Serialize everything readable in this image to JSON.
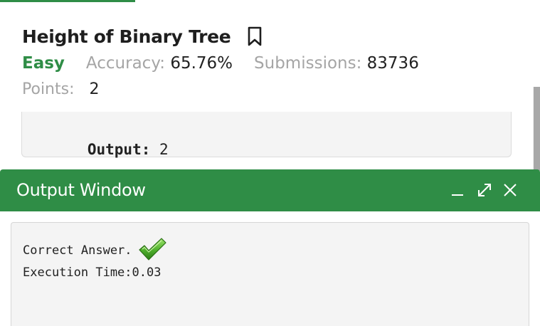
{
  "problem": {
    "title": "Height of Binary Tree",
    "difficulty": "Easy",
    "accuracy_label": "Accuracy:",
    "accuracy_value": "65.76%",
    "submissions_label": "Submissions:",
    "submissions_value": "83736",
    "points_label": "Points:",
    "points_value": "2"
  },
  "example": {
    "output_label": "Output:",
    "output_value": "2"
  },
  "output_window": {
    "title": "Output Window",
    "result_text": "Correct Answer.",
    "execution_time": "Execution Time:0.03"
  },
  "icons": {
    "bookmark": "bookmark-icon",
    "minimize": "minimize-icon",
    "maximize": "maximize-icon",
    "close": "close-icon",
    "check": "check-icon"
  },
  "colors": {
    "accent": "#2f8d46",
    "muted": "#a5a5a5",
    "panel_bg": "#f4f4f4"
  }
}
